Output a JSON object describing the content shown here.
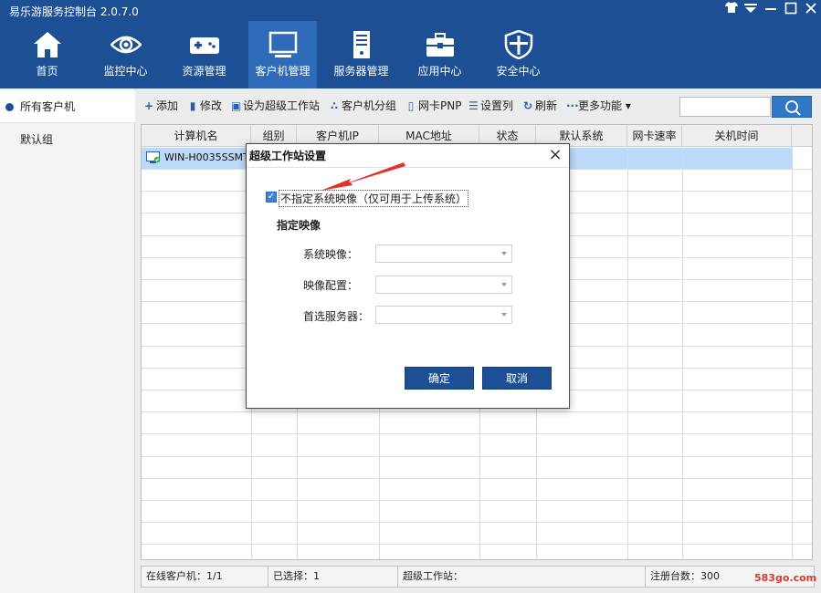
{
  "app": {
    "title": "易乐游服务控制台 2.0.7.0"
  },
  "window_controls": [
    "shirt-icon",
    "menu-icon",
    "minimize-icon",
    "maximize-icon",
    "close-icon"
  ],
  "nav": [
    {
      "label": "首页",
      "icon": "home-icon"
    },
    {
      "label": "监控中心",
      "icon": "eye-icon"
    },
    {
      "label": "资源管理",
      "icon": "gamepad-icon"
    },
    {
      "label": "客户机管理",
      "icon": "monitor-icon",
      "active": true
    },
    {
      "label": "服务器管理",
      "icon": "server-icon"
    },
    {
      "label": "应用中心",
      "icon": "toolbox-icon"
    },
    {
      "label": "安全中心",
      "icon": "shield-icon"
    }
  ],
  "sidebar": {
    "items": [
      {
        "label": "所有客户机",
        "selected": true
      },
      {
        "label": "默认组"
      }
    ]
  },
  "toolbar": {
    "add": "添加",
    "edit": "修改",
    "super_ws": "设为超级工作站",
    "group": "客户机分组",
    "pnp": "网卡PNP",
    "columns": "设置列",
    "refresh": "刷新",
    "more": "更多功能"
  },
  "search": {
    "placeholder": ""
  },
  "table": {
    "columns": [
      "计算机名",
      "组别",
      "客户机IP",
      "MAC地址",
      "状态",
      "默认系统",
      "网卡速率",
      "关机时间"
    ],
    "rows": [
      {
        "name": "WIN-H0035SSMTI0",
        "selected": true
      }
    ]
  },
  "status": {
    "online": "在线客户机：1/1",
    "selected": "已选择：1",
    "super": "超级工作站：",
    "registered": "注册台数：300"
  },
  "dialog": {
    "title": "超级工作站设置",
    "checkbox_label": "不指定系统映像（仅可用于上传系统）",
    "checked": true,
    "section": "指定映像",
    "fields": [
      {
        "label": "系统映像：",
        "value": ""
      },
      {
        "label": "映像配置：",
        "value": ""
      },
      {
        "label": "首选服务器：",
        "value": ""
      }
    ],
    "ok": "确定",
    "cancel": "取消"
  },
  "watermark": "583go.com",
  "colors": {
    "primary": "#1c4f94",
    "nav_active": "#2f6bb8",
    "row_selected": "#bcd9f7",
    "annotation_arrow": "#e0312b"
  }
}
